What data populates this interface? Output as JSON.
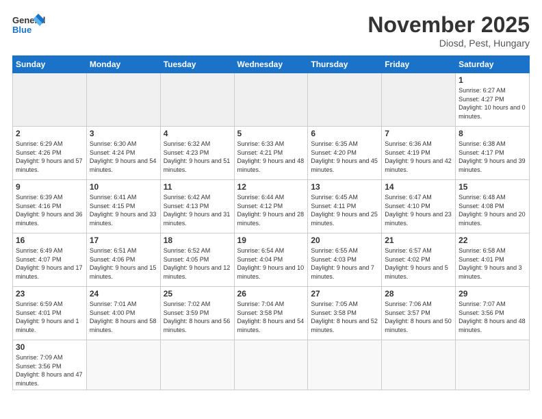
{
  "header": {
    "logo_general": "General",
    "logo_blue": "Blue",
    "month_title": "November 2025",
    "location": "Diosd, Pest, Hungary"
  },
  "weekdays": [
    "Sunday",
    "Monday",
    "Tuesday",
    "Wednesday",
    "Thursday",
    "Friday",
    "Saturday"
  ],
  "rows": [
    [
      {
        "day": "",
        "info": ""
      },
      {
        "day": "",
        "info": ""
      },
      {
        "day": "",
        "info": ""
      },
      {
        "day": "",
        "info": ""
      },
      {
        "day": "",
        "info": ""
      },
      {
        "day": "",
        "info": ""
      },
      {
        "day": "1",
        "info": "Sunrise: 6:27 AM\nSunset: 4:27 PM\nDaylight: 10 hours and 0 minutes."
      }
    ],
    [
      {
        "day": "2",
        "info": "Sunrise: 6:29 AM\nSunset: 4:26 PM\nDaylight: 9 hours and 57 minutes."
      },
      {
        "day": "3",
        "info": "Sunrise: 6:30 AM\nSunset: 4:24 PM\nDaylight: 9 hours and 54 minutes."
      },
      {
        "day": "4",
        "info": "Sunrise: 6:32 AM\nSunset: 4:23 PM\nDaylight: 9 hours and 51 minutes."
      },
      {
        "day": "5",
        "info": "Sunrise: 6:33 AM\nSunset: 4:21 PM\nDaylight: 9 hours and 48 minutes."
      },
      {
        "day": "6",
        "info": "Sunrise: 6:35 AM\nSunset: 4:20 PM\nDaylight: 9 hours and 45 minutes."
      },
      {
        "day": "7",
        "info": "Sunrise: 6:36 AM\nSunset: 4:19 PM\nDaylight: 9 hours and 42 minutes."
      },
      {
        "day": "8",
        "info": "Sunrise: 6:38 AM\nSunset: 4:17 PM\nDaylight: 9 hours and 39 minutes."
      }
    ],
    [
      {
        "day": "9",
        "info": "Sunrise: 6:39 AM\nSunset: 4:16 PM\nDaylight: 9 hours and 36 minutes."
      },
      {
        "day": "10",
        "info": "Sunrise: 6:41 AM\nSunset: 4:15 PM\nDaylight: 9 hours and 33 minutes."
      },
      {
        "day": "11",
        "info": "Sunrise: 6:42 AM\nSunset: 4:13 PM\nDaylight: 9 hours and 31 minutes."
      },
      {
        "day": "12",
        "info": "Sunrise: 6:44 AM\nSunset: 4:12 PM\nDaylight: 9 hours and 28 minutes."
      },
      {
        "day": "13",
        "info": "Sunrise: 6:45 AM\nSunset: 4:11 PM\nDaylight: 9 hours and 25 minutes."
      },
      {
        "day": "14",
        "info": "Sunrise: 6:47 AM\nSunset: 4:10 PM\nDaylight: 9 hours and 23 minutes."
      },
      {
        "day": "15",
        "info": "Sunrise: 6:48 AM\nSunset: 4:08 PM\nDaylight: 9 hours and 20 minutes."
      }
    ],
    [
      {
        "day": "16",
        "info": "Sunrise: 6:49 AM\nSunset: 4:07 PM\nDaylight: 9 hours and 17 minutes."
      },
      {
        "day": "17",
        "info": "Sunrise: 6:51 AM\nSunset: 4:06 PM\nDaylight: 9 hours and 15 minutes."
      },
      {
        "day": "18",
        "info": "Sunrise: 6:52 AM\nSunset: 4:05 PM\nDaylight: 9 hours and 12 minutes."
      },
      {
        "day": "19",
        "info": "Sunrise: 6:54 AM\nSunset: 4:04 PM\nDaylight: 9 hours and 10 minutes."
      },
      {
        "day": "20",
        "info": "Sunrise: 6:55 AM\nSunset: 4:03 PM\nDaylight: 9 hours and 7 minutes."
      },
      {
        "day": "21",
        "info": "Sunrise: 6:57 AM\nSunset: 4:02 PM\nDaylight: 9 hours and 5 minutes."
      },
      {
        "day": "22",
        "info": "Sunrise: 6:58 AM\nSunset: 4:01 PM\nDaylight: 9 hours and 3 minutes."
      }
    ],
    [
      {
        "day": "23",
        "info": "Sunrise: 6:59 AM\nSunset: 4:01 PM\nDaylight: 9 hours and 1 minute."
      },
      {
        "day": "24",
        "info": "Sunrise: 7:01 AM\nSunset: 4:00 PM\nDaylight: 8 hours and 58 minutes."
      },
      {
        "day": "25",
        "info": "Sunrise: 7:02 AM\nSunset: 3:59 PM\nDaylight: 8 hours and 56 minutes."
      },
      {
        "day": "26",
        "info": "Sunrise: 7:04 AM\nSunset: 3:58 PM\nDaylight: 8 hours and 54 minutes."
      },
      {
        "day": "27",
        "info": "Sunrise: 7:05 AM\nSunset: 3:58 PM\nDaylight: 8 hours and 52 minutes."
      },
      {
        "day": "28",
        "info": "Sunrise: 7:06 AM\nSunset: 3:57 PM\nDaylight: 8 hours and 50 minutes."
      },
      {
        "day": "29",
        "info": "Sunrise: 7:07 AM\nSunset: 3:56 PM\nDaylight: 8 hours and 48 minutes."
      }
    ],
    [
      {
        "day": "30",
        "info": "Sunrise: 7:09 AM\nSunset: 3:56 PM\nDaylight: 8 hours and 47 minutes."
      },
      {
        "day": "",
        "info": ""
      },
      {
        "day": "",
        "info": ""
      },
      {
        "day": "",
        "info": ""
      },
      {
        "day": "",
        "info": ""
      },
      {
        "day": "",
        "info": ""
      },
      {
        "day": "",
        "info": ""
      }
    ]
  ]
}
